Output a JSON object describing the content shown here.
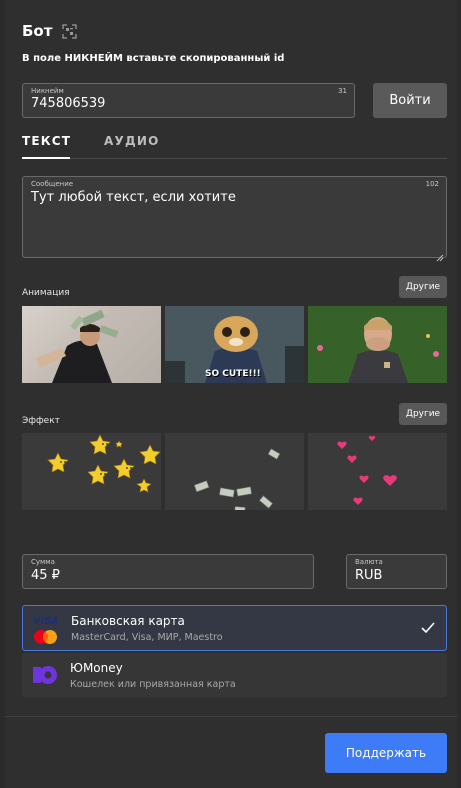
{
  "header": {
    "title": "Бот",
    "qr_icon": "qr-scan-icon"
  },
  "instruction": "В поле НИКНЕЙМ вставьте скопированный id",
  "nickname": {
    "label": "Никнейм",
    "value": "745806539",
    "counter": "31"
  },
  "enter_button": "Войти",
  "tabs": [
    {
      "label": "ТЕКСТ",
      "active": true
    },
    {
      "label": "АУДИО",
      "active": false
    }
  ],
  "message": {
    "label": "Сообщение",
    "value": "Тут любой текст, если хотите",
    "counter": "102"
  },
  "animation": {
    "label": "Анимация",
    "other_label": "Другие",
    "items": [
      {
        "name": "man-throwing-money",
        "caption": ""
      },
      {
        "name": "zootopia-cheetah",
        "caption": "SO CUTE!!!"
      },
      {
        "name": "man-laughing",
        "caption": ""
      }
    ]
  },
  "effect": {
    "label": "Эффект",
    "other_label": "Другие",
    "items": [
      {
        "name": "stars-effect"
      },
      {
        "name": "money-effect"
      },
      {
        "name": "hearts-effect"
      }
    ]
  },
  "amount": {
    "label": "Сумма",
    "value": "45 ₽"
  },
  "currency": {
    "label": "Валюта",
    "value": "RUB"
  },
  "payment_options": [
    {
      "title": "Банковская карта",
      "subtitle": "MasterCard, Visa, МИР, Maestro",
      "selected": true
    },
    {
      "title": "ЮMoney",
      "subtitle": "Кошелек или привязанная карта",
      "selected": false
    }
  ],
  "support_button": "Поддержать",
  "colors": {
    "accent": "#3d7bf7",
    "selected_border": "#4a78d8",
    "background": "#2f2f2f"
  }
}
